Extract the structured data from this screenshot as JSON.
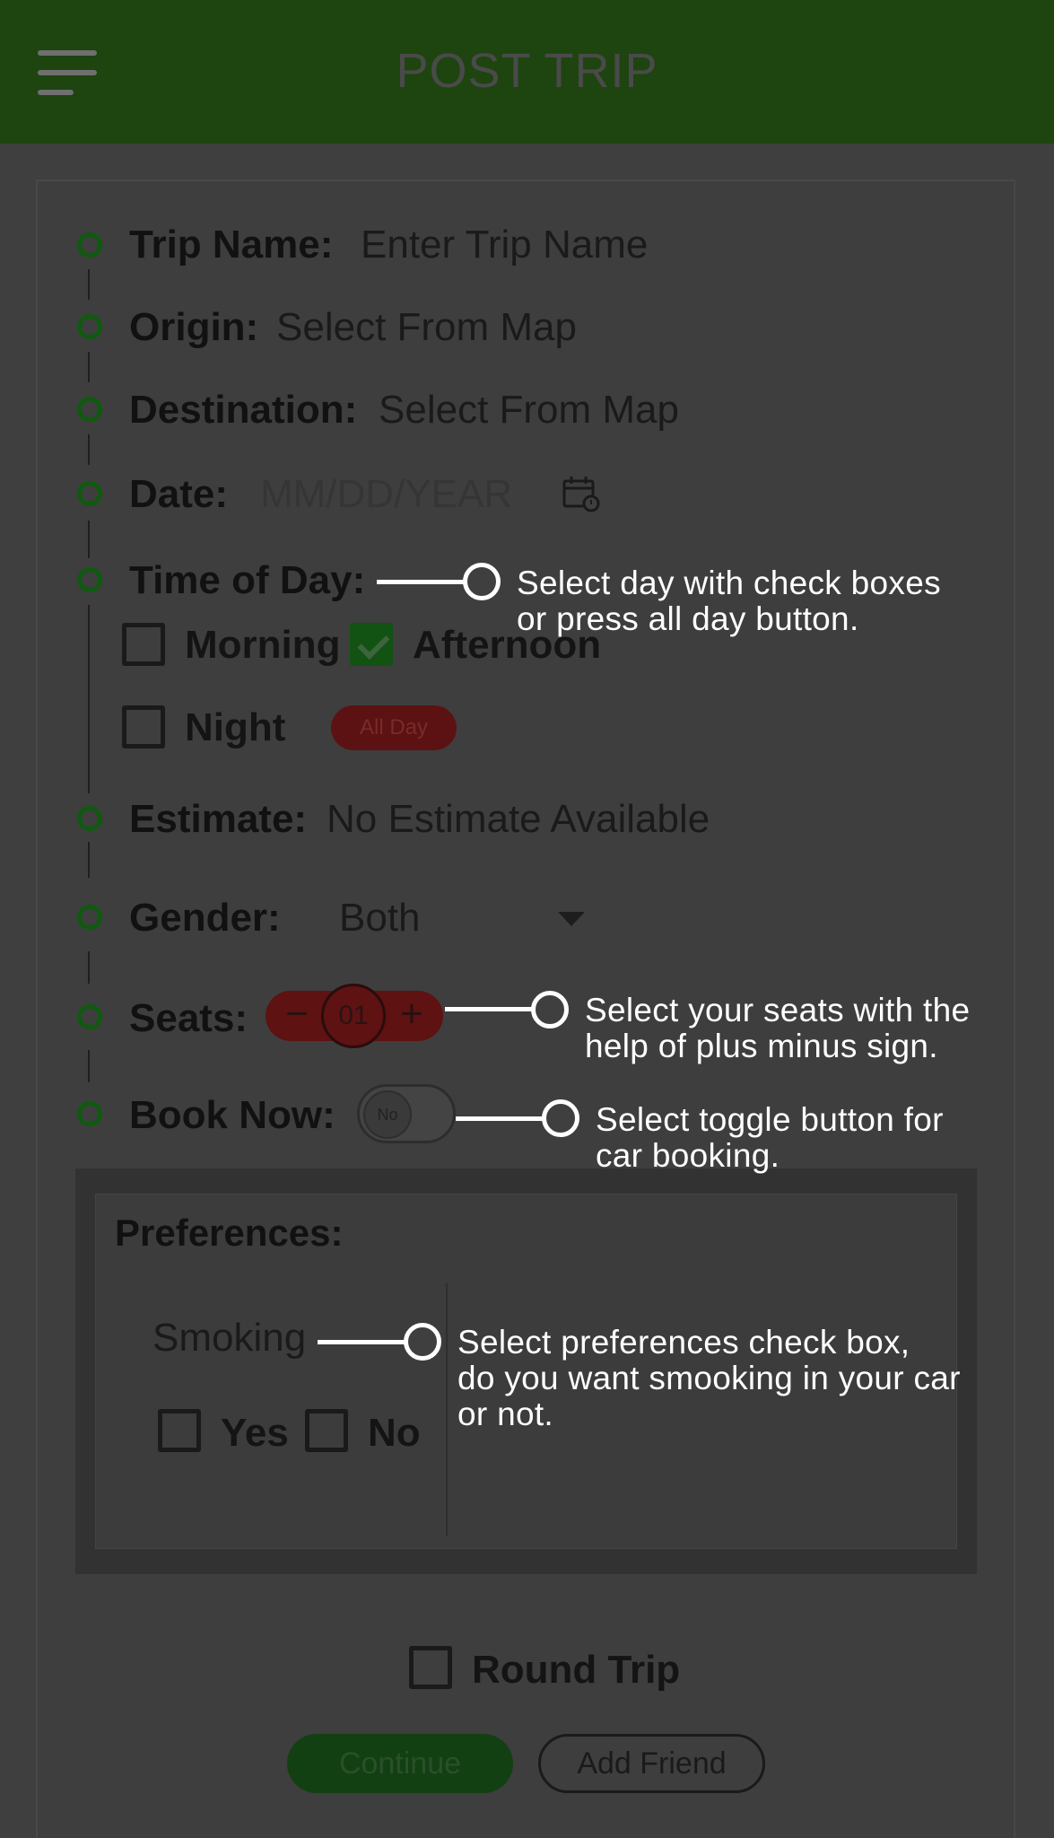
{
  "header": {
    "title": "POST TRIP",
    "menu_icon": "hamburger-menu-icon"
  },
  "form": {
    "trip_name": {
      "label": "Trip Name:",
      "value": "Enter Trip Name"
    },
    "origin": {
      "label": "Origin:",
      "value": "Select From Map"
    },
    "destination": {
      "label": "Destination:",
      "value": "Select From Map"
    },
    "date": {
      "label": "Date:",
      "placeholder": "MM/DD/YEAR",
      "icon": "calendar-icon"
    },
    "time_of_day": {
      "label": "Time of Day:",
      "morning": {
        "label": "Morning",
        "checked": false
      },
      "afternoon": {
        "label": "Afternoon",
        "checked": true
      },
      "night": {
        "label": "Night",
        "checked": false
      },
      "all_day_label": "All Day"
    },
    "estimate": {
      "label": "Estimate:",
      "value": "No Estimate Available"
    },
    "gender": {
      "label": "Gender:",
      "value": "Both"
    },
    "seats": {
      "label": "Seats:",
      "value": "01",
      "minus": "−",
      "plus": "+"
    },
    "book_now": {
      "label": "Book Now:",
      "toggle_label": "No",
      "on": false
    },
    "preferences": {
      "title": "Preferences:",
      "smoking_label": "Smoking",
      "yes_label": "Yes",
      "no_label": "No"
    },
    "round_trip": {
      "label": "Round Trip",
      "checked": false
    },
    "continue_label": "Continue",
    "add_friend_label": "Add Friend"
  },
  "callouts": {
    "time_of_day": [
      "Select day with check boxes",
      "or press all day button."
    ],
    "seats": [
      "Select your seats with the",
      "help of plus minus sign."
    ],
    "book_now": [
      "Select toggle button for",
      "car booking."
    ],
    "preferences": [
      "Select preferences check box,",
      "do you want smooking in your car",
      "or not."
    ]
  }
}
